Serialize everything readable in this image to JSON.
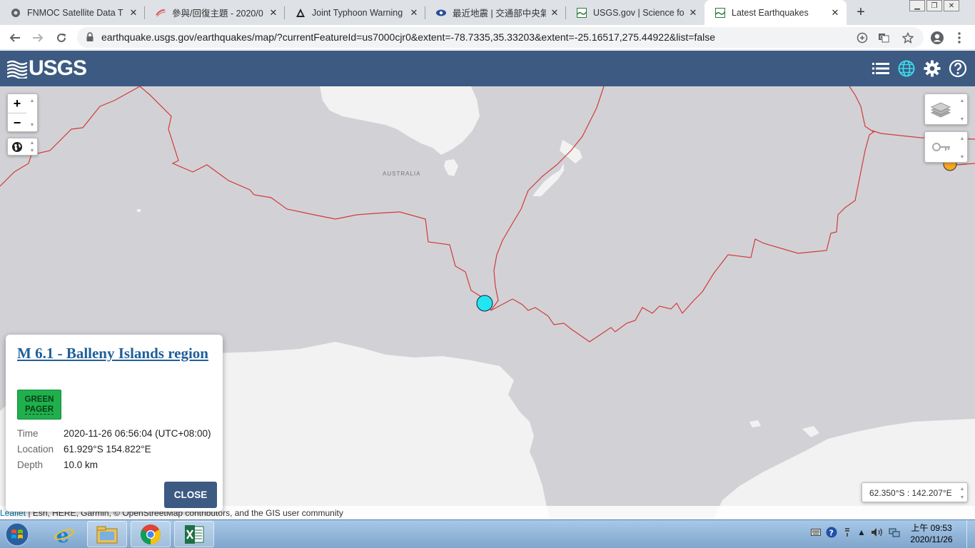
{
  "browser": {
    "tabs": [
      {
        "title": "FNMOC Satellite Data T",
        "icon": "globe-icon"
      },
      {
        "title": "參與/回復主題 - 2020/0",
        "icon": "swirl-icon"
      },
      {
        "title": "Joint Typhoon Warning",
        "icon": "triangle-warning-icon"
      },
      {
        "title": "最近地震 | 交通部中央氣",
        "icon": "cwb-eye-icon"
      },
      {
        "title": "USGS.gov | Science for",
        "icon": "usgs-icon"
      },
      {
        "title": "Latest Earthquakes",
        "icon": "usgs-icon",
        "active": true
      }
    ],
    "new_tab": "+",
    "url": "earthquake.usgs.gov/earthquakes/map/?currentFeatureId=us7000cjr0&extent=-78.7335,35.33203&extent=-25.16517,275.44922&list=false"
  },
  "header": {
    "logo_text": "USGS"
  },
  "map": {
    "region_label": "AUSTRALIA",
    "zoom_in": "+",
    "zoom_out": "−",
    "coordinates": "62.350°S : 142.207°E",
    "attribution_link": "Leaflet",
    "attribution_text": " | Esri, HERE, Garmin, © OpenStreetMap contributors, and the GIS user community",
    "colors": {
      "ocean": "#d2d2d6",
      "land": "#f2f2f2",
      "plate_boundary": "#d23a3a",
      "quake_selected": "#22e5f0",
      "quake_other": "#f5a623"
    }
  },
  "popup": {
    "title": "M 6.1 - Balleny Islands region",
    "pager_line1": "GREEN",
    "pager_line2": "PAGER",
    "details": [
      {
        "label": "Time",
        "value": "2020-11-26 06:56:04 (UTC+08:00)"
      },
      {
        "label": "Location",
        "value": "61.929°S 154.822°E"
      },
      {
        "label": "Depth",
        "value": "10.0 km"
      }
    ],
    "close_label": "CLOSE"
  },
  "taskbar": {
    "clock_time": "上午 09:53",
    "clock_date": "2020/11/26"
  }
}
